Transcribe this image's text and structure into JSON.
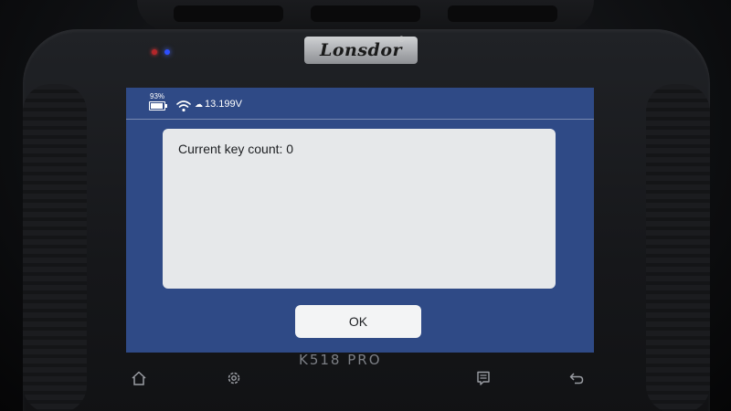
{
  "device": {
    "brand": "Lonsdor",
    "registered_mark": "®",
    "model": "K518 PRO"
  },
  "status_bar": {
    "battery_percent_label": "93%",
    "battery_level": 0.93,
    "voltage": "13.199V",
    "icons": [
      "battery-icon",
      "wifi-icon",
      "voltage-icon"
    ]
  },
  "dialog": {
    "message": "Current key count: 0",
    "ok_label": "OK"
  },
  "soft_keys": [
    "home-icon",
    "settings-icon",
    "menu-icon",
    "back-icon"
  ],
  "colors": {
    "screen_background": "#2f4a86",
    "dialog_background": "#e6e8ea",
    "button_background": "#f3f4f5"
  }
}
